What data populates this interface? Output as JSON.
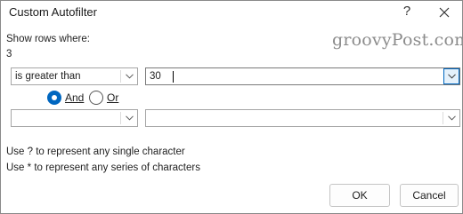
{
  "dialog": {
    "title": "Custom Autofilter",
    "help_glyph": "?",
    "show_rows_label": "Show rows where:",
    "field_name": "3",
    "watermark": "groovyPost.com"
  },
  "criteria1": {
    "operator": "is greater than",
    "value": "30"
  },
  "logic": {
    "and_label": "And",
    "or_label": "Or",
    "selected": "And"
  },
  "criteria2": {
    "operator": "",
    "value": ""
  },
  "hints": {
    "single_char": "Use ? to represent any single character",
    "series_chars": "Use * to represent any series of characters"
  },
  "buttons": {
    "ok_label": "OK",
    "cancel_label": "Cancel"
  },
  "colors": {
    "accent": "#0067c0",
    "watermark": "#8c8c8c",
    "border": "#a6a6a6"
  }
}
